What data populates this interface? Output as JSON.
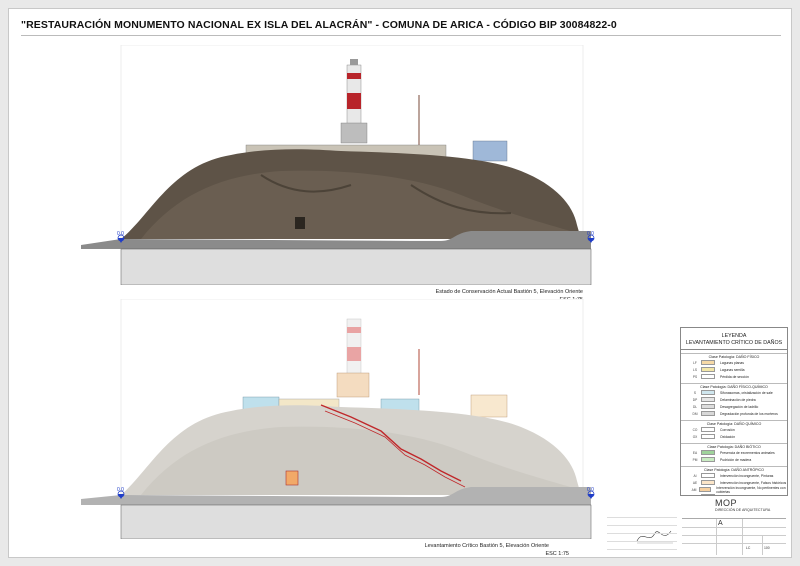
{
  "document": {
    "title": "\"RESTAURACIÓN MONUMENTO NACIONAL EX ISLA DEL ALACRÁN\" - COMUNA DE ARICA - CÓDIGO BIP 30084822-0"
  },
  "elevations": {
    "top": {
      "caption": "Estado de Conservación Actual Bastión 5, Elevación Oriente",
      "scale": "ESC 1:75",
      "level_left": "0.0",
      "level_right": "0.0"
    },
    "bottom": {
      "caption": "Levantamiento Crítico Bastión 5, Elevación Oriente",
      "scale": "ESC 1:75",
      "level_left": "0.0",
      "level_right": "0.0"
    }
  },
  "legend": {
    "title_line1": "LEYENDA",
    "title_line2": "LEVANTAMIENTO CRÍTICO DE DAÑOS",
    "classes": [
      {
        "name": "Clase Patología: DAÑO FÍSICO",
        "items": [
          {
            "code": "LF",
            "label": "Lagunas planas",
            "color": "#f6d9a6"
          },
          {
            "code": "LS",
            "label": "Lagunas semilla",
            "color": "#f3e7a8"
          },
          {
            "code": "PS",
            "label": "Pérdida de sección",
            "color": "#ffffff"
          }
        ]
      },
      {
        "name": "Clase Patología: DAÑO FÍSICO-QUÍMICO",
        "items": [
          {
            "code": "S",
            "label": "Sifonasomas, cristalización de sale",
            "color": "#cfe6ee"
          },
          {
            "code": "DP",
            "label": "Delaminación de piedra",
            "color": "#e6e6e6"
          },
          {
            "code": "DL",
            "label": "Desagregación de ladrillo",
            "color": "#dddddd"
          },
          {
            "code": "DM",
            "label": "Degradación profunda de los morteros",
            "color": "#d8d8d8"
          }
        ]
      },
      {
        "name": "Clase Patología: DAÑO QUÍMICO",
        "items": [
          {
            "code": "CO",
            "label": "Corrosión",
            "color": "#ffffff"
          },
          {
            "code": "OX",
            "label": "Oxidación",
            "color": "#ffffff"
          }
        ]
      },
      {
        "name": "Clase Patología: DAÑO BIÓTICO",
        "items": [
          {
            "code": "EA",
            "label": "Presencia de excrementos animales",
            "color": "#9fd39b"
          },
          {
            "code": "PM",
            "label": "Pudrición de madera",
            "color": "#c9ecc2"
          }
        ]
      },
      {
        "name": "Clase Patología: DAÑO ANTRÓPICO",
        "items": [
          {
            "code": "AI",
            "label": "Intervención incongruente, Pinturas",
            "color": "#ffffff"
          },
          {
            "code": "AE",
            "label": "Intervención incongruente, Falsos históricos",
            "color": "#fbe5c8"
          },
          {
            "code": "AM",
            "label": "Intervención incongruente, No pertinentes con cubiertas",
            "color": "#f6d0a0"
          },
          {
            "code": "AR",
            "label": "Repellos",
            "color": "#f2a968"
          }
        ]
      }
    ]
  },
  "title_block": {
    "ministry": "MOP",
    "direction": "DIRECCIÓN DE ARQUITECTURA",
    "sheet_letter": "A",
    "code_1": "LC",
    "code_2": "100"
  }
}
